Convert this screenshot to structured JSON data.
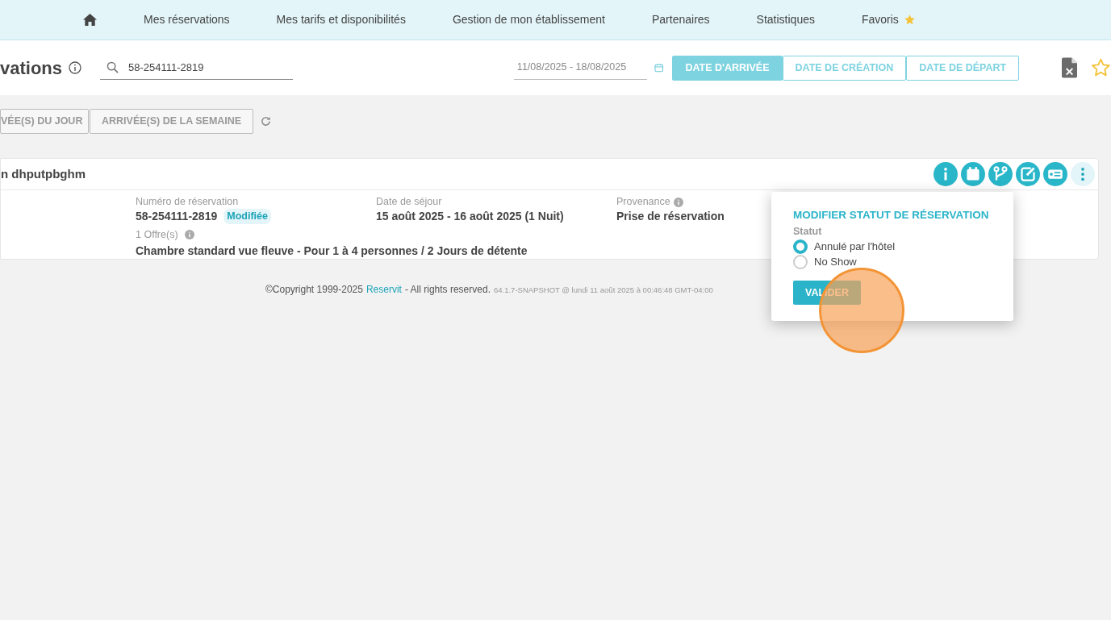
{
  "nav": {
    "items": [
      {
        "kind": "home"
      },
      {
        "kind": "text",
        "label": "Mes réservations"
      },
      {
        "kind": "text",
        "label": "Mes tarifs et disponibilités"
      },
      {
        "kind": "text",
        "label": "Gestion de mon établissement"
      },
      {
        "kind": "text",
        "label": "Partenaires"
      },
      {
        "kind": "text",
        "label": "Statistiques"
      },
      {
        "kind": "favorite",
        "label": "Favoris"
      }
    ]
  },
  "header": {
    "title": "vations",
    "search": {
      "value": "58-254111-2819"
    },
    "date_range": {
      "value": "11/08/2025 - 18/08/2025"
    },
    "date_modes": [
      {
        "label": "DATE D'ARRIVÉE",
        "selected": true
      },
      {
        "label": "DATE DE CRÉATION",
        "selected": false
      },
      {
        "label": "DATE DE DÉPART",
        "selected": false
      }
    ]
  },
  "filters": [
    {
      "label": "VÉE(S) DU JOUR"
    },
    {
      "label": "ARRIVÉE(S) DE LA SEMAINE"
    }
  ],
  "reservation": {
    "guest": "n dhputpbghm",
    "actions": [
      {
        "kind": "info"
      },
      {
        "kind": "calendar"
      },
      {
        "kind": "branch"
      },
      {
        "kind": "edit"
      },
      {
        "kind": "payment"
      },
      {
        "kind": "more"
      }
    ],
    "number_label": "Numéro de réservation",
    "number": "58-254111-2819",
    "badge": "Modifiée",
    "stay_label": "Date de séjour",
    "stay": "15 août 2025 - 16 août 2025 (1 Nuit)",
    "source_label": "Provenance",
    "source": "Prise de réservation",
    "offers_label": "1 Offre(s)",
    "offer": "Chambre standard vue fleuve - Pour 1 à 4 personnes / 2 Jours de détente"
  },
  "footer": {
    "copyright": "©Copyright 1999-2025",
    "brand": "Reservit",
    "rights": "- All rights reserved.",
    "version": "64.1.7-SNAPSHOT @ lundi 11 août 2025 à 00:46:48 GMT-04:00"
  },
  "popup": {
    "title": "MODIFIER STATUT DE RÉSERVATION",
    "field_label": "Statut",
    "options": [
      {
        "label": "Annulé par l'hôtel",
        "selected": true
      },
      {
        "label": "No Show",
        "selected": false
      }
    ],
    "button": "VALIDER"
  },
  "click_indicator": true
}
